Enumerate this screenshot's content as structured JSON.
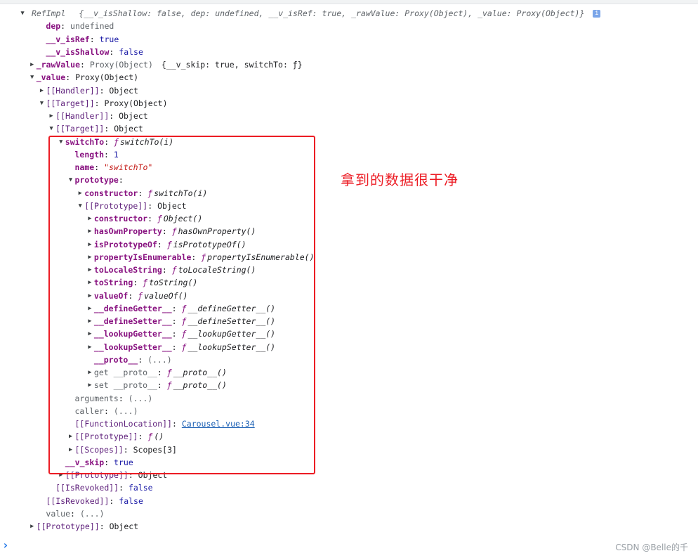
{
  "header": {
    "class_name": "RefImpl",
    "preview": "{__v_isShallow: false, dep: undefined, __v_isRef: true, _rawValue: Proxy(Object), _value: Proxy(Object)}",
    "info_badge": "i"
  },
  "rows": [
    {
      "depth": 2,
      "tri": "none",
      "key": "dep",
      "kind": "own",
      "sep": ": ",
      "val": "undefined",
      "vtype": "nul"
    },
    {
      "depth": 2,
      "tri": "none",
      "key": "__v_isRef",
      "kind": "own",
      "sep": ": ",
      "val": "true",
      "vtype": "bool"
    },
    {
      "depth": 2,
      "tri": "none",
      "key": "__v_isShallow",
      "kind": "own",
      "sep": ": ",
      "val": "false",
      "vtype": "bool"
    },
    {
      "depth": 1,
      "tri": "right",
      "key": "_rawValue",
      "kind": "own",
      "sep": ": ",
      "val": "Proxy(Object)",
      "vtype": "nul",
      "extra": "{__v_skip: true, switchTo: ƒ}"
    },
    {
      "depth": 1,
      "tri": "down",
      "key": "_value",
      "kind": "own",
      "sep": ": ",
      "val": "Proxy(Object)",
      "vtype": "obj"
    },
    {
      "depth": 2,
      "tri": "right",
      "key": "[[Handler]]",
      "kind": "int",
      "sep": ": ",
      "val": "Object",
      "vtype": "obj"
    },
    {
      "depth": 2,
      "tri": "down",
      "key": "[[Target]]",
      "kind": "int",
      "sep": ": ",
      "val": "Proxy(Object)",
      "vtype": "obj"
    },
    {
      "depth": 3,
      "tri": "right",
      "key": "[[Handler]]",
      "kind": "int",
      "sep": ": ",
      "val": "Object",
      "vtype": "obj"
    },
    {
      "depth": 3,
      "tri": "down",
      "key": "[[Target]]",
      "kind": "int",
      "sep": ": ",
      "val": "Object",
      "vtype": "obj"
    },
    {
      "depth": 4,
      "tri": "down",
      "key": "switchTo",
      "kind": "own",
      "sep": ": ",
      "fsym": "ƒ",
      "val": "switchTo(i)",
      "vtype": "fn"
    },
    {
      "depth": 5,
      "tri": "none",
      "key": "length",
      "kind": "own",
      "sep": ": ",
      "val": "1",
      "vtype": "num"
    },
    {
      "depth": 5,
      "tri": "none",
      "key": "name",
      "kind": "own",
      "sep": ": ",
      "val": "\"switchTo\"",
      "vtype": "str"
    },
    {
      "depth": 5,
      "tri": "down",
      "key": "prototype",
      "kind": "own",
      "sep": ":",
      "val": "",
      "vtype": "obj"
    },
    {
      "depth": 6,
      "tri": "right",
      "key": "constructor",
      "kind": "own",
      "sep": ": ",
      "fsym": "ƒ",
      "val": "switchTo(i)",
      "vtype": "fn"
    },
    {
      "depth": 6,
      "tri": "down",
      "key": "[[Prototype]]",
      "kind": "int",
      "sep": ": ",
      "val": "Object",
      "vtype": "obj"
    },
    {
      "depth": 7,
      "tri": "right",
      "key": "constructor",
      "kind": "own",
      "sep": ": ",
      "fsym": "ƒ",
      "val": "Object()",
      "vtype": "fn"
    },
    {
      "depth": 7,
      "tri": "right",
      "key": "hasOwnProperty",
      "kind": "own",
      "sep": ": ",
      "fsym": "ƒ",
      "val": "hasOwnProperty()",
      "vtype": "fn"
    },
    {
      "depth": 7,
      "tri": "right",
      "key": "isPrototypeOf",
      "kind": "own",
      "sep": ": ",
      "fsym": "ƒ",
      "val": "isPrototypeOf()",
      "vtype": "fn"
    },
    {
      "depth": 7,
      "tri": "right",
      "key": "propertyIsEnumerable",
      "kind": "own",
      "sep": ": ",
      "fsym": "ƒ",
      "val": "propertyIsEnumerable()",
      "vtype": "fn"
    },
    {
      "depth": 7,
      "tri": "right",
      "key": "toLocaleString",
      "kind": "own",
      "sep": ": ",
      "fsym": "ƒ",
      "val": "toLocaleString()",
      "vtype": "fn"
    },
    {
      "depth": 7,
      "tri": "right",
      "key": "toString",
      "kind": "own",
      "sep": ": ",
      "fsym": "ƒ",
      "val": "toString()",
      "vtype": "fn"
    },
    {
      "depth": 7,
      "tri": "right",
      "key": "valueOf",
      "kind": "own",
      "sep": ": ",
      "fsym": "ƒ",
      "val": "valueOf()",
      "vtype": "fn"
    },
    {
      "depth": 7,
      "tri": "right",
      "key": "__defineGetter__",
      "kind": "own",
      "sep": ": ",
      "fsym": "ƒ",
      "val": "__defineGetter__()",
      "vtype": "fn"
    },
    {
      "depth": 7,
      "tri": "right",
      "key": "__defineSetter__",
      "kind": "own",
      "sep": ": ",
      "fsym": "ƒ",
      "val": "__defineSetter__()",
      "vtype": "fn"
    },
    {
      "depth": 7,
      "tri": "right",
      "key": "__lookupGetter__",
      "kind": "own",
      "sep": ": ",
      "fsym": "ƒ",
      "val": "__lookupGetter__()",
      "vtype": "fn"
    },
    {
      "depth": 7,
      "tri": "right",
      "key": "__lookupSetter__",
      "kind": "own",
      "sep": ": ",
      "fsym": "ƒ",
      "val": "__lookupSetter__()",
      "vtype": "fn"
    },
    {
      "depth": 7,
      "tri": "none",
      "key": "__proto__",
      "kind": "own",
      "sep": ": ",
      "val": "(...)",
      "vtype": "lazy"
    },
    {
      "depth": 7,
      "tri": "right",
      "key": "get __proto__",
      "kind": "dim",
      "sep": ": ",
      "fsym": "ƒ",
      "val": "__proto__()",
      "vtype": "fn"
    },
    {
      "depth": 7,
      "tri": "right",
      "key": "set __proto__",
      "kind": "dim",
      "sep": ": ",
      "fsym": "ƒ",
      "val": "__proto__()",
      "vtype": "fn"
    },
    {
      "depth": 5,
      "tri": "none",
      "key": "arguments",
      "kind": "dim",
      "sep": ": ",
      "val": "(...)",
      "vtype": "lazy"
    },
    {
      "depth": 5,
      "tri": "none",
      "key": "caller",
      "kind": "dim",
      "sep": ": ",
      "val": "(...)",
      "vtype": "lazy"
    },
    {
      "depth": 5,
      "tri": "none",
      "key": "[[FunctionLocation]]",
      "kind": "int",
      "sep": ": ",
      "val": "Carousel.vue:34",
      "vtype": "link"
    },
    {
      "depth": 5,
      "tri": "right",
      "key": "[[Prototype]]",
      "kind": "int",
      "sep": ": ",
      "fsym": "ƒ",
      "val": "()",
      "vtype": "fn"
    },
    {
      "depth": 5,
      "tri": "right",
      "key": "[[Scopes]]",
      "kind": "int",
      "sep": ": ",
      "val": "Scopes[3]",
      "vtype": "obj"
    },
    {
      "depth": 4,
      "tri": "none",
      "key": "__v_skip",
      "kind": "own",
      "sep": ": ",
      "val": "true",
      "vtype": "bool"
    },
    {
      "depth": 4,
      "tri": "right",
      "key": "[[Prototype]]",
      "kind": "int",
      "sep": ": ",
      "val": "Object",
      "vtype": "obj"
    },
    {
      "depth": 3,
      "tri": "none",
      "key": "[[IsRevoked]]",
      "kind": "int",
      "sep": ": ",
      "val": "false",
      "vtype": "bool"
    },
    {
      "depth": 2,
      "tri": "none",
      "key": "[[IsRevoked]]",
      "kind": "int",
      "sep": ": ",
      "val": "false",
      "vtype": "bool"
    },
    {
      "depth": 2,
      "tri": "none",
      "key": "value",
      "kind": "dim",
      "sep": ": ",
      "val": "(...)",
      "vtype": "lazy"
    },
    {
      "depth": 1,
      "tri": "right",
      "key": "[[Prototype]]",
      "kind": "int",
      "sep": ": ",
      "val": "Object",
      "vtype": "obj"
    }
  ],
  "annotation": "拿到的数据很干净",
  "prompt_glyph": "›",
  "watermark": "CSDN @Belle的千",
  "colors": {
    "highlight": "#ec1c24",
    "key": "#881280",
    "number": "#1a1aa6",
    "string": "#c41a16",
    "link": "#1a5fb4"
  }
}
